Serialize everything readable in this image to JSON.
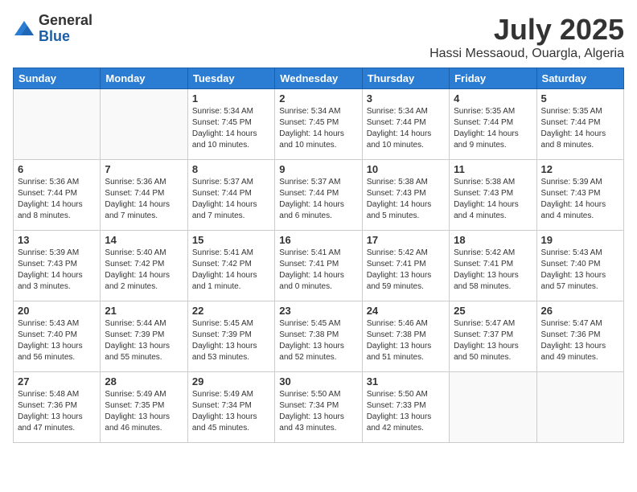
{
  "logo": {
    "general": "General",
    "blue": "Blue"
  },
  "title": "July 2025",
  "location": "Hassi Messaoud, Ouargla, Algeria",
  "days_of_week": [
    "Sunday",
    "Monday",
    "Tuesday",
    "Wednesday",
    "Thursday",
    "Friday",
    "Saturday"
  ],
  "weeks": [
    [
      {
        "day": "",
        "info": ""
      },
      {
        "day": "",
        "info": ""
      },
      {
        "day": "1",
        "info": "Sunrise: 5:34 AM\nSunset: 7:45 PM\nDaylight: 14 hours and 10 minutes."
      },
      {
        "day": "2",
        "info": "Sunrise: 5:34 AM\nSunset: 7:45 PM\nDaylight: 14 hours and 10 minutes."
      },
      {
        "day": "3",
        "info": "Sunrise: 5:34 AM\nSunset: 7:44 PM\nDaylight: 14 hours and 10 minutes."
      },
      {
        "day": "4",
        "info": "Sunrise: 5:35 AM\nSunset: 7:44 PM\nDaylight: 14 hours and 9 minutes."
      },
      {
        "day": "5",
        "info": "Sunrise: 5:35 AM\nSunset: 7:44 PM\nDaylight: 14 hours and 8 minutes."
      }
    ],
    [
      {
        "day": "6",
        "info": "Sunrise: 5:36 AM\nSunset: 7:44 PM\nDaylight: 14 hours and 8 minutes."
      },
      {
        "day": "7",
        "info": "Sunrise: 5:36 AM\nSunset: 7:44 PM\nDaylight: 14 hours and 7 minutes."
      },
      {
        "day": "8",
        "info": "Sunrise: 5:37 AM\nSunset: 7:44 PM\nDaylight: 14 hours and 7 minutes."
      },
      {
        "day": "9",
        "info": "Sunrise: 5:37 AM\nSunset: 7:44 PM\nDaylight: 14 hours and 6 minutes."
      },
      {
        "day": "10",
        "info": "Sunrise: 5:38 AM\nSunset: 7:43 PM\nDaylight: 14 hours and 5 minutes."
      },
      {
        "day": "11",
        "info": "Sunrise: 5:38 AM\nSunset: 7:43 PM\nDaylight: 14 hours and 4 minutes."
      },
      {
        "day": "12",
        "info": "Sunrise: 5:39 AM\nSunset: 7:43 PM\nDaylight: 14 hours and 4 minutes."
      }
    ],
    [
      {
        "day": "13",
        "info": "Sunrise: 5:39 AM\nSunset: 7:43 PM\nDaylight: 14 hours and 3 minutes."
      },
      {
        "day": "14",
        "info": "Sunrise: 5:40 AM\nSunset: 7:42 PM\nDaylight: 14 hours and 2 minutes."
      },
      {
        "day": "15",
        "info": "Sunrise: 5:41 AM\nSunset: 7:42 PM\nDaylight: 14 hours and 1 minute."
      },
      {
        "day": "16",
        "info": "Sunrise: 5:41 AM\nSunset: 7:41 PM\nDaylight: 14 hours and 0 minutes."
      },
      {
        "day": "17",
        "info": "Sunrise: 5:42 AM\nSunset: 7:41 PM\nDaylight: 13 hours and 59 minutes."
      },
      {
        "day": "18",
        "info": "Sunrise: 5:42 AM\nSunset: 7:41 PM\nDaylight: 13 hours and 58 minutes."
      },
      {
        "day": "19",
        "info": "Sunrise: 5:43 AM\nSunset: 7:40 PM\nDaylight: 13 hours and 57 minutes."
      }
    ],
    [
      {
        "day": "20",
        "info": "Sunrise: 5:43 AM\nSunset: 7:40 PM\nDaylight: 13 hours and 56 minutes."
      },
      {
        "day": "21",
        "info": "Sunrise: 5:44 AM\nSunset: 7:39 PM\nDaylight: 13 hours and 55 minutes."
      },
      {
        "day": "22",
        "info": "Sunrise: 5:45 AM\nSunset: 7:39 PM\nDaylight: 13 hours and 53 minutes."
      },
      {
        "day": "23",
        "info": "Sunrise: 5:45 AM\nSunset: 7:38 PM\nDaylight: 13 hours and 52 minutes."
      },
      {
        "day": "24",
        "info": "Sunrise: 5:46 AM\nSunset: 7:38 PM\nDaylight: 13 hours and 51 minutes."
      },
      {
        "day": "25",
        "info": "Sunrise: 5:47 AM\nSunset: 7:37 PM\nDaylight: 13 hours and 50 minutes."
      },
      {
        "day": "26",
        "info": "Sunrise: 5:47 AM\nSunset: 7:36 PM\nDaylight: 13 hours and 49 minutes."
      }
    ],
    [
      {
        "day": "27",
        "info": "Sunrise: 5:48 AM\nSunset: 7:36 PM\nDaylight: 13 hours and 47 minutes."
      },
      {
        "day": "28",
        "info": "Sunrise: 5:49 AM\nSunset: 7:35 PM\nDaylight: 13 hours and 46 minutes."
      },
      {
        "day": "29",
        "info": "Sunrise: 5:49 AM\nSunset: 7:34 PM\nDaylight: 13 hours and 45 minutes."
      },
      {
        "day": "30",
        "info": "Sunrise: 5:50 AM\nSunset: 7:34 PM\nDaylight: 13 hours and 43 minutes."
      },
      {
        "day": "31",
        "info": "Sunrise: 5:50 AM\nSunset: 7:33 PM\nDaylight: 13 hours and 42 minutes."
      },
      {
        "day": "",
        "info": ""
      },
      {
        "day": "",
        "info": ""
      }
    ]
  ]
}
